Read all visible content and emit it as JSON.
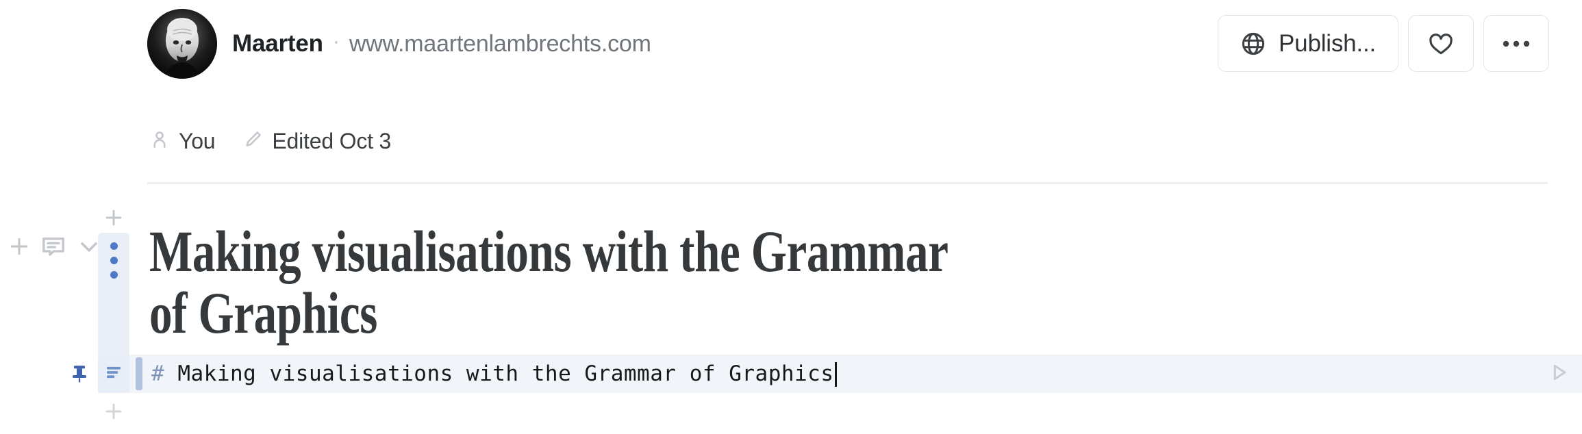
{
  "header": {
    "author_name": "Maarten",
    "separator": "·",
    "site_url": "www.maartenlambrechts.com",
    "avatar_icon": "user-avatar-photo",
    "actions": {
      "publish_label": "Publish...",
      "publish_icon": "globe-icon",
      "favorite_icon": "heart-icon",
      "more_icon": "ellipsis-icon"
    }
  },
  "meta": {
    "owner_icon": "person-icon",
    "owner_label": "You",
    "edited_icon": "pencil-icon",
    "edited_label": "Edited Oct 3"
  },
  "gutter": {
    "add_icon": "plus-icon",
    "comment_icon": "comment-icon",
    "collapse_icon": "chevron-down-icon",
    "drag_handle_icon": "vertical-dots-icon",
    "add_above_icon": "plus-icon",
    "add_below_icon": "plus-icon"
  },
  "document": {
    "heading": "Making visualisations with the Grammar of Graphics"
  },
  "code_line": {
    "pin_icon": "pin-icon",
    "lines_icon": "paragraph-lines-icon",
    "hash_token": "#",
    "source": " Making visualisations with the Grammar of Graphics",
    "run_icon": "play-icon"
  },
  "colors": {
    "accent_blue": "#4e78c8",
    "code_band": "#f1f4f9",
    "handle_strip": "#eaeff7",
    "divider": "#eceef0",
    "text_dark": "#1f2225",
    "text_muted": "#70757b"
  }
}
